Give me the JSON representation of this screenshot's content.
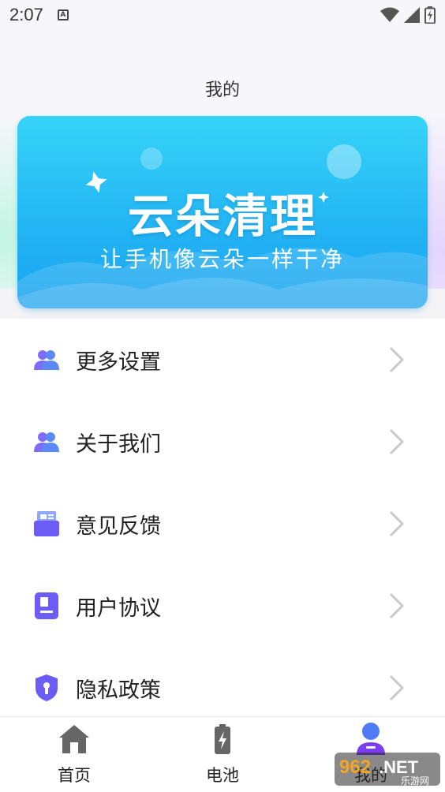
{
  "status_bar": {
    "time": "2:07",
    "notification_letter": "A"
  },
  "header": {
    "title": "我的"
  },
  "banner": {
    "title": "云朵清理",
    "subtitle": "让手机像云朵一样干净"
  },
  "menu": {
    "items": [
      {
        "label": "更多设置",
        "icon": "users-icon"
      },
      {
        "label": "关于我们",
        "icon": "users-icon"
      },
      {
        "label": "意见反馈",
        "icon": "feedback-icon"
      },
      {
        "label": "用户协议",
        "icon": "document-icon"
      },
      {
        "label": "隐私政策",
        "icon": "shield-icon"
      }
    ]
  },
  "tab_bar": {
    "tabs": [
      {
        "label": "首页",
        "icon": "home-icon"
      },
      {
        "label": "电池",
        "icon": "battery-icon"
      },
      {
        "label": "我的",
        "icon": "user-icon"
      }
    ],
    "active_index": 2
  },
  "watermark": {
    "text": "962.NET",
    "subtext": "乐游网"
  },
  "colors": {
    "accent": "#6a5cf5",
    "banner": "#22b4f4",
    "chevron": "#c8c8c8"
  }
}
